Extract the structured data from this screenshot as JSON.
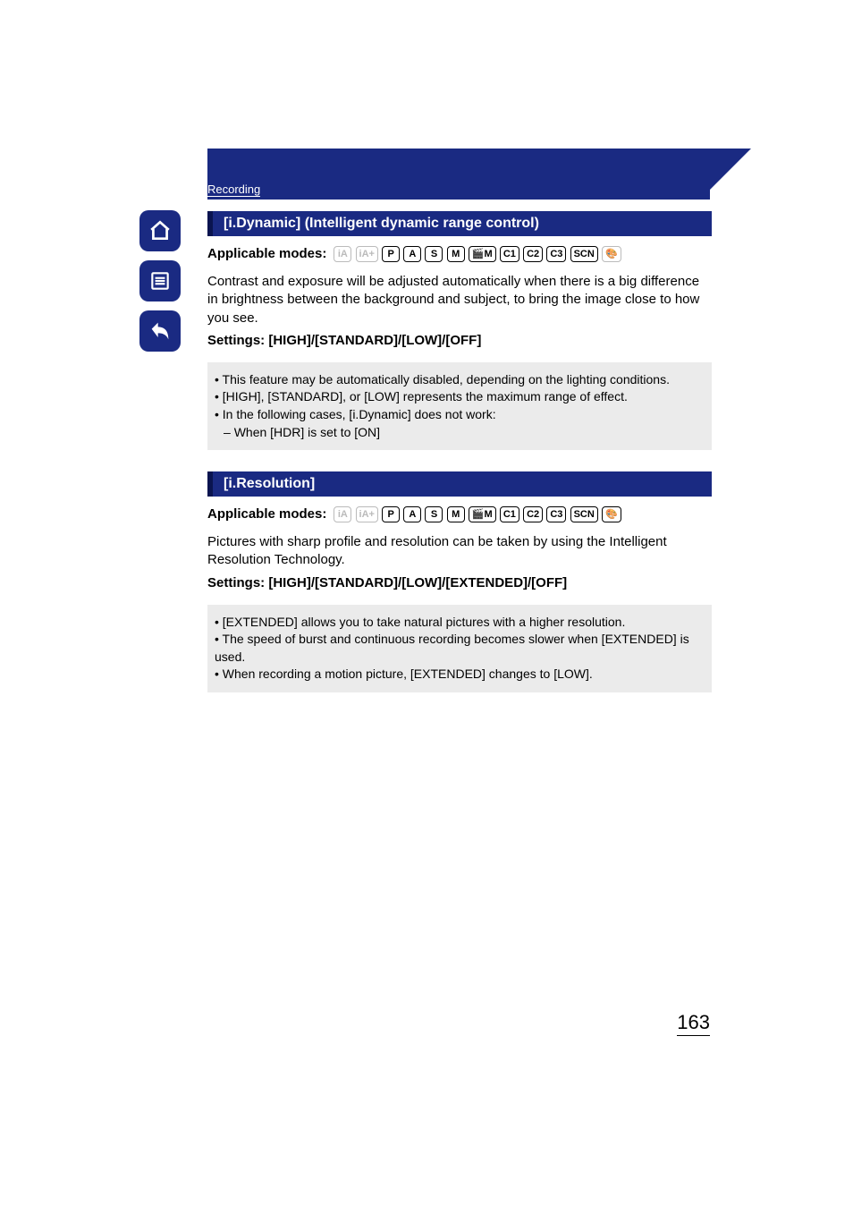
{
  "breadcrumb": "Recording",
  "sidebar": {
    "home": "home-icon",
    "toc": "toc-icon",
    "back": "back-icon"
  },
  "section1": {
    "title": "[i.Dynamic] (Intelligent dynamic range control)",
    "applicable_label": "Applicable modes:",
    "modes": [
      {
        "label": "iA",
        "dim": true
      },
      {
        "label": "iA+",
        "dim": true
      },
      {
        "label": "P",
        "dim": false
      },
      {
        "label": "A",
        "dim": false
      },
      {
        "label": "S",
        "dim": false
      },
      {
        "label": "M",
        "dim": false
      },
      {
        "label": "🎬M",
        "dim": false
      },
      {
        "label": "C1",
        "dim": false
      },
      {
        "label": "C2",
        "dim": false
      },
      {
        "label": "C3",
        "dim": false
      },
      {
        "label": "SCN",
        "dim": false
      },
      {
        "label": "🎨",
        "dim": true
      }
    ],
    "body": "Contrast and exposure will be adjusted automatically when there is a big difference in brightness between the background and subject, to bring the image close to how you see.",
    "settings": "Settings: [HIGH]/[STANDARD]/[LOW]/[OFF]",
    "notes": [
      "This feature may be automatically disabled, depending on the lighting conditions.",
      "[HIGH], [STANDARD], or [LOW] represents the maximum range of effect.",
      "In the following cases, [i.Dynamic] does not work:"
    ],
    "sub_note": "When [HDR] is set to [ON]"
  },
  "section2": {
    "title": "[i.Resolution]",
    "applicable_label": "Applicable modes:",
    "modes": [
      {
        "label": "iA",
        "dim": true
      },
      {
        "label": "iA+",
        "dim": true
      },
      {
        "label": "P",
        "dim": false
      },
      {
        "label": "A",
        "dim": false
      },
      {
        "label": "S",
        "dim": false
      },
      {
        "label": "M",
        "dim": false
      },
      {
        "label": "🎬M",
        "dim": false
      },
      {
        "label": "C1",
        "dim": false
      },
      {
        "label": "C2",
        "dim": false
      },
      {
        "label": "C3",
        "dim": false
      },
      {
        "label": "SCN",
        "dim": false
      },
      {
        "label": "🎨",
        "dim": false
      }
    ],
    "body": "Pictures with sharp profile and resolution can be taken by using the Intelligent Resolution Technology.",
    "settings": "Settings: [HIGH]/[STANDARD]/[LOW]/[EXTENDED]/[OFF]",
    "notes": [
      "[EXTENDED] allows you to take natural pictures with a higher resolution.",
      "The speed of burst and continuous recording becomes slower when [EXTENDED] is used.",
      "When recording a motion picture, [EXTENDED] changes to [LOW]."
    ]
  },
  "page_number": "163"
}
